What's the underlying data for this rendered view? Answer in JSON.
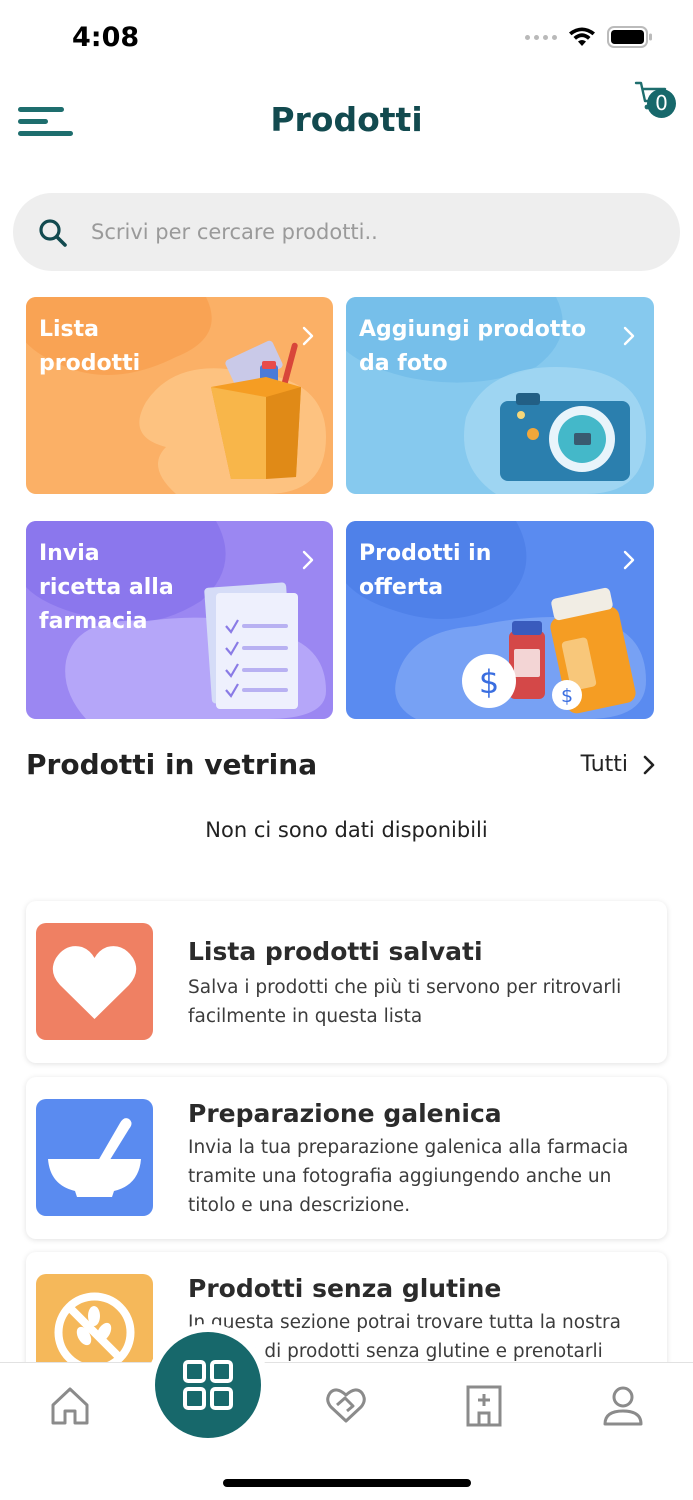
{
  "status_bar": {
    "time": "4:08"
  },
  "header": {
    "title": "Prodotti",
    "cart_count": "0"
  },
  "search": {
    "placeholder": "Scrivi per cercare prodotti.."
  },
  "tiles": [
    {
      "title": "Lista prodotti",
      "color": "#fbb066"
    },
    {
      "title": "Aggiungi prodotto da foto",
      "color": "#86c9ee"
    },
    {
      "title": "Invia ricetta alla farmacia",
      "color": "#9b87f2"
    },
    {
      "title": "Prodotti in offerta",
      "color": "#5a8bf0"
    }
  ],
  "showcase": {
    "title": "Prodotti in vetrina",
    "all_label": "Tutti",
    "empty_message": "Non ci sono dati disponibili"
  },
  "features": [
    {
      "title": "Lista prodotti salvati",
      "description": "Salva i prodotti che più ti servono per ritrovarli facilmente in questa lista",
      "icon": "heart-icon",
      "color": "#ef8063"
    },
    {
      "title": "Preparazione galenica",
      "description": "Invia la tua preparazione galenica alla farmacia tramite una fotografia aggiungendo anche un titolo e una descrizione.",
      "icon": "mortar-pestle-icon",
      "color": "#5a8bf0"
    },
    {
      "title": "Prodotti senza glutine",
      "description": "In questa sezione potrai trovare tutta la nostra gamma di prodotti senza glutine e prenotarli",
      "icon": "gluten-free-icon",
      "color": "#f5b85a"
    }
  ],
  "tabbar": {
    "items": [
      "home-icon",
      "heart-handshake-icon",
      "grid-icon",
      "pharmacy-icon",
      "profile-icon"
    ],
    "accent": "#17686b"
  }
}
